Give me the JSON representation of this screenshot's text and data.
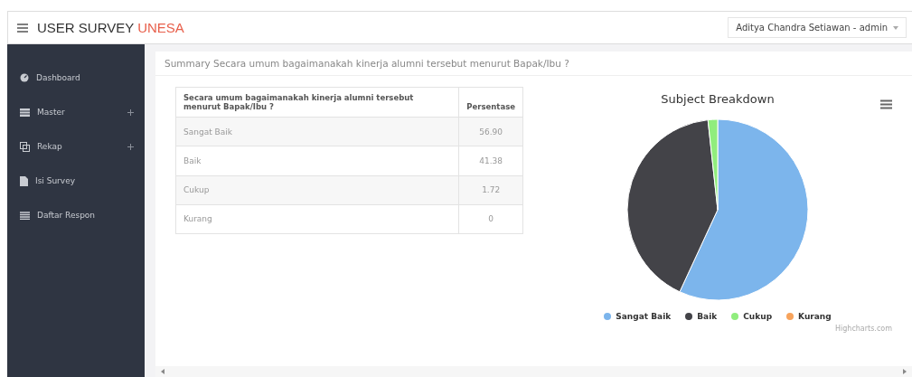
{
  "header": {
    "brand": "USER SURVEY",
    "brand_accent": "UNESA",
    "user": "Aditya Chandra Setiawan - admin"
  },
  "sidebar": {
    "items": [
      {
        "label": "Dashboard",
        "kind": "dashboard",
        "expandable": false
      },
      {
        "label": "Master",
        "kind": "master",
        "expandable": true
      },
      {
        "label": "Rekap",
        "kind": "rekap",
        "expandable": true
      },
      {
        "label": "Isi Survey",
        "kind": "file",
        "expandable": false
      },
      {
        "label": "Daftar Respon",
        "kind": "list",
        "expandable": false
      }
    ]
  },
  "panel": {
    "title": "Summary Secara umum bagaimanakah kinerja alumni tersebut menurut Bapak/Ibu ?"
  },
  "table": {
    "columns": [
      "Secara umum bagaimanakah kinerja alumni tersebut menurut Bapak/Ibu ?",
      "Persentase"
    ],
    "rows": [
      [
        "Sangat Baik",
        "56.90"
      ],
      [
        "Baik",
        "41.38"
      ],
      [
        "Cukup",
        "1.72"
      ],
      [
        "Kurang",
        "0"
      ]
    ]
  },
  "chart": {
    "credit": "Highcharts.com",
    "chart_data": {
      "type": "pie",
      "title": "Subject Breakdown",
      "categories": [
        "Sangat Baik",
        "Baik",
        "Cukup",
        "Kurang"
      ],
      "values": [
        56.9,
        41.38,
        1.72,
        0
      ],
      "colors": [
        "#7cb5ec",
        "#434348",
        "#90ed7d",
        "#f7a35c"
      ]
    }
  }
}
